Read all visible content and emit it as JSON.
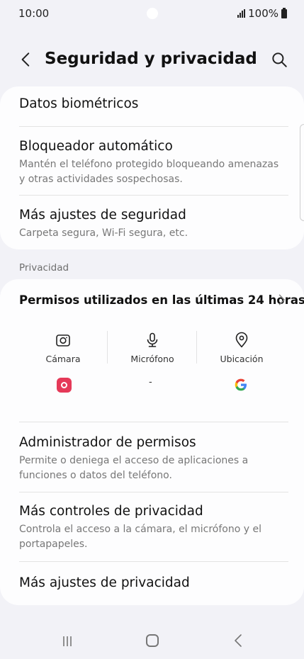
{
  "status_bar": {
    "time": "10:00",
    "battery": "100%"
  },
  "header": {
    "title": "Seguridad y privacidad"
  },
  "security_items": [
    {
      "title": "Datos biométricos",
      "subtitle": ""
    },
    {
      "title": "Bloqueador automático",
      "subtitle": "Mantén el teléfono protegido bloqueando amenazas y otras actividades sospechosas."
    },
    {
      "title": "Más ajustes de seguridad",
      "subtitle": "Carpeta segura, Wi-Fi segura, etc."
    }
  ],
  "privacy_section": {
    "label": "Privacidad",
    "permissions_title": "Permisos utilizados en las últimas 24 horas",
    "permissions": [
      {
        "label": "Cámara",
        "icon": "camera-icon",
        "app": "camera-app-icon"
      },
      {
        "label": "Micrófono",
        "icon": "microphone-icon",
        "app": "-"
      },
      {
        "label": "Ubicación",
        "icon": "location-icon",
        "app": "google-icon"
      }
    ],
    "items": [
      {
        "title": "Administrador de permisos",
        "subtitle": "Permite o deniega el acceso de aplicaciones a funciones o datos del teléfono."
      },
      {
        "title": "Más controles de privacidad",
        "subtitle": "Controla el acceso a la cámara, el micrófono y el portapapeles."
      },
      {
        "title": "Más ajustes de privacidad",
        "subtitle": ""
      }
    ]
  },
  "colors": {
    "background": "#f2f2f7",
    "card": "#fdfdfe",
    "camera_app": "#e53958"
  }
}
